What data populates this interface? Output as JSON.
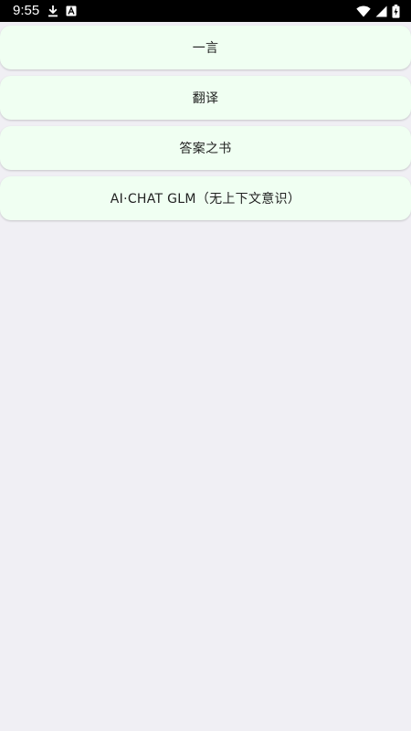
{
  "status_bar": {
    "time": "9:55",
    "icons": [
      "download-icon",
      "a-badge-icon",
      "wifi-icon",
      "cellular-signal-icon",
      "battery-charging-icon"
    ]
  },
  "menu": {
    "items": [
      {
        "label": "一言"
      },
      {
        "label": "翻译"
      },
      {
        "label": "答案之书"
      },
      {
        "label": "AI·CHAT GLM（无上下文意识）"
      }
    ]
  },
  "colors": {
    "background": "#f0eff4",
    "card": "#f0fff2",
    "status_bar": "#000000",
    "text": "#222222"
  }
}
